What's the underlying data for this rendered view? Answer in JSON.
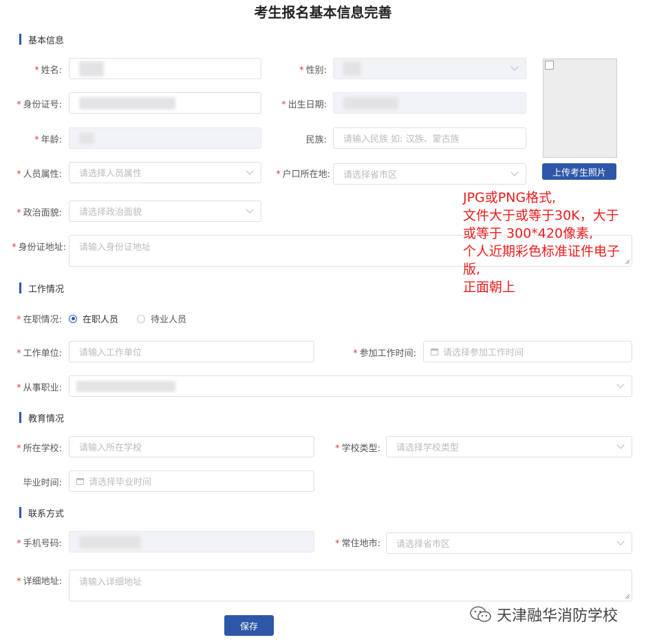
{
  "page": {
    "title": "考生报名基本信息完善"
  },
  "sections": {
    "basic": "基本信息",
    "work": "工作情况",
    "education": "教育情况",
    "contact": "联系方式"
  },
  "required_mark": "*",
  "basic": {
    "name_label": "姓名:",
    "gender_label": "性别:",
    "id_label": "身份证号:",
    "birth_label": "出生日期:",
    "age_label": "年龄:",
    "ethnicity_label": "民族:",
    "ethnicity_placeholder": "请输入民族 如: 汉族、蒙古族",
    "person_type_label": "人员属性:",
    "person_type_placeholder": "请选择人员属性",
    "hukou_label": "户口所在地:",
    "hukou_placeholder": "请选择省市区",
    "political_label": "政治面貌:",
    "political_placeholder": "请选择政治面貌",
    "id_address_label": "身份证地址:",
    "id_address_placeholder": "请输入身份证地址"
  },
  "photo": {
    "upload_label": "上传考生照片",
    "note_lines": [
      "JPG或PNG格式,",
      "文件大于或等于30K，大于",
      "或等于 300*420像素,",
      "个人近期彩色标准证件电子",
      "版,",
      "正面朝上"
    ]
  },
  "work": {
    "status_label": "在职情况:",
    "option_employed": "在职人员",
    "option_unemployed": "待业人员",
    "selected": "在职人员",
    "unit_label": "工作单位:",
    "unit_placeholder": "请输入工作单位",
    "start_label": "参加工作时间:",
    "start_placeholder": "请选择参加工作时间",
    "occupation_label": "从事职业:"
  },
  "education": {
    "school_label": "所在学校:",
    "school_placeholder": "请输入所在学校",
    "school_type_label": "学校类型:",
    "school_type_placeholder": "请选择学校类型",
    "grad_label": "毕业时间:",
    "grad_placeholder": "请选择毕业时间"
  },
  "contact": {
    "phone_label": "手机号码:",
    "residence_label": "常住地市:",
    "residence_placeholder": "请选择省市区",
    "address_label": "详细地址:",
    "address_placeholder": "请输入详细地址"
  },
  "actions": {
    "save": "保存"
  },
  "watermark": "天津融华消防学校",
  "icons": [
    "calendar-icon",
    "chevron-down-icon",
    "wechat-icon",
    "radio-icon",
    "resize-handle-icon"
  ],
  "colors": {
    "primary": "#2e57a8",
    "required": "#e23b3b",
    "note": "#ee1b1b"
  }
}
